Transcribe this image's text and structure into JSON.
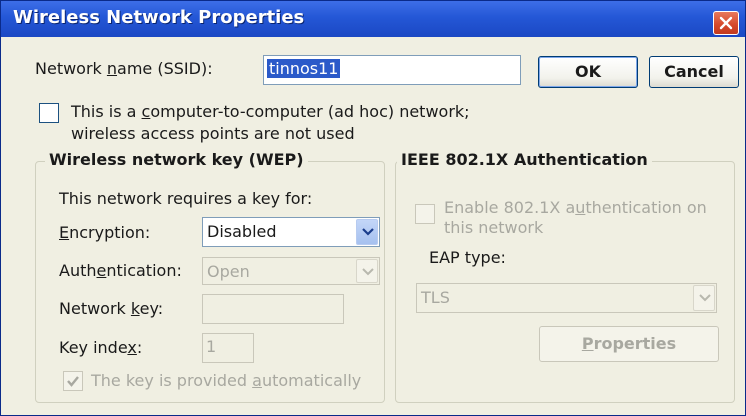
{
  "window": {
    "title": "Wireless Network Properties"
  },
  "ssid": {
    "label": "Network name (SSID):",
    "value": "tinnos11"
  },
  "buttons": {
    "ok": "OK",
    "cancel": "Cancel",
    "properties": "Properties"
  },
  "adhoc": {
    "line1": "This is a computer-to-computer (ad hoc) network;",
    "line2": "wireless access points are not used",
    "checked": false
  },
  "wep": {
    "title": "Wireless network key (WEP)",
    "requires": "This network requires a key for:",
    "encryption_label": "Encryption:",
    "encryption_value": "Disabled",
    "authentication_label": "Authentication:",
    "authentication_value": "Open",
    "network_key_label": "Network key:",
    "network_key_value": "",
    "key_index_label": "Key index:",
    "key_index_value": "1",
    "auto_key_label": "The key is provided automatically",
    "auto_key_checked": true
  },
  "ieee": {
    "title": "IEEE 802.1X Authentication",
    "enable_line1": "Enable 802.1X authentication on",
    "enable_line2": "this network",
    "eap_label": "EAP type:",
    "eap_value": "TLS"
  },
  "colors": {
    "title_bar": "#2457d6",
    "window_bg": "#f0efe2",
    "close_button": "#d5482a",
    "selection": "#2b5ac9",
    "disabled_text": "#a8a8a0"
  },
  "icons": {
    "close": "close-icon",
    "dropdown": "chevron-down-icon",
    "check": "checkmark-icon"
  }
}
